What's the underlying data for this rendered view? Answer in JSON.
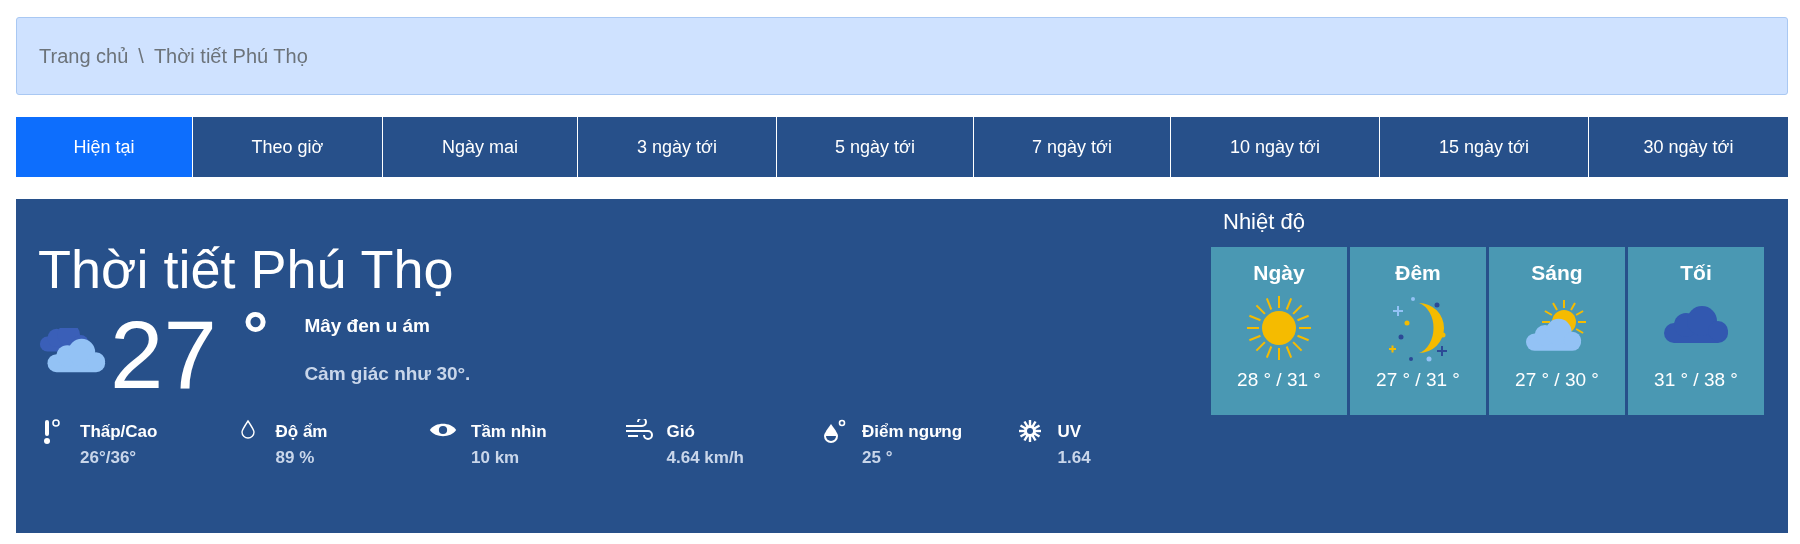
{
  "breadcrumb": [
    {
      "label": "Trang chủ"
    },
    {
      "label": "Thời tiết Phú Thọ"
    }
  ],
  "breadcrumb_separator": "\\",
  "tabs": [
    {
      "label": "Hiện tại",
      "selected": true
    },
    {
      "label": "Theo giờ",
      "selected": false
    },
    {
      "label": "Ngày mai",
      "selected": false
    },
    {
      "label": "3 ngày tới",
      "selected": false
    },
    {
      "label": "5 ngày tới",
      "selected": false
    },
    {
      "label": "7 ngày tới",
      "selected": false
    },
    {
      "label": "10 ngày tới",
      "selected": false
    },
    {
      "label": "15 ngày tới",
      "selected": false
    },
    {
      "label": "30 ngày tới",
      "selected": false
    }
  ],
  "current": {
    "title": "Thời tiết Phú Thọ",
    "temperature": "27",
    "degree": "°",
    "condition": "Mây đen u ám",
    "feels_like": "Cảm giác như 30°."
  },
  "details": [
    {
      "label": "Thấp/Cao",
      "value": "26°/36°"
    },
    {
      "label": "Độ ẩm",
      "value": "89 %"
    },
    {
      "label": "Tầm nhìn",
      "value": "10 km"
    },
    {
      "label": "Gió",
      "value": "4.64 km/h"
    },
    {
      "label": "Điểm ngưng",
      "value": "25 °"
    },
    {
      "label": "UV",
      "value": "1.64"
    }
  ],
  "temperature_panel": {
    "title": "Nhiệt độ",
    "periods": [
      {
        "label": "Ngày",
        "range": "28 ° / 31 °"
      },
      {
        "label": "Đêm",
        "range": "27 ° / 31 °"
      },
      {
        "label": "Sáng",
        "range": "27 ° / 30 °"
      },
      {
        "label": "Tối",
        "range": "31 ° / 38 °"
      }
    ]
  }
}
